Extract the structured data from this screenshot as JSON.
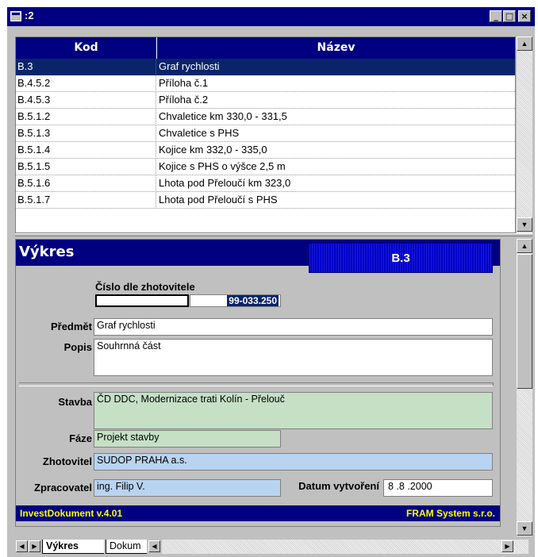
{
  "window": {
    "title": ":2",
    "minimize_glyph": "_",
    "maximize_glyph": "□",
    "close_glyph": "×"
  },
  "list": {
    "columns": [
      "Kod",
      "Název"
    ],
    "rows": [
      {
        "kod": "B.3",
        "nazev": "Graf rychlosti"
      },
      {
        "kod": "B.4.5.2",
        "nazev": "Příloha č.1"
      },
      {
        "kod": "B.4.5.3",
        "nazev": "Příloha č.2"
      },
      {
        "kod": "B.5.1.2",
        "nazev": "Chvaletice km 330,0 - 331,5"
      },
      {
        "kod": "B.5.1.3",
        "nazev": "Chvaletice s PHS"
      },
      {
        "kod": "B.5.1.4",
        "nazev": "Kojice km 332,0 - 335,0"
      },
      {
        "kod": "B.5.1.5",
        "nazev": "Kojice s PHS o výšce 2,5 m"
      },
      {
        "kod": "B.5.1.6",
        "nazev": "Lhota pod Přeloučí km 323,0"
      },
      {
        "kod": "B.5.1.7",
        "nazev": "Lhota pod Přeloučí s PHS"
      }
    ]
  },
  "form": {
    "title": "Výkres",
    "code": "B.3",
    "cislo_label": "Číslo dle zhotovitele",
    "cislo_value": "99-033.250",
    "predmet_label": "Předmět",
    "predmet_value": "Graf rychlosti",
    "popis_label": "Popis",
    "popis_value": "Souhrnná část",
    "stavba_label": "Stavba",
    "stavba_value": "ČD DDC, Modernizace trati Kolín - Přelouč",
    "faze_label": "Fáze",
    "faze_value": "Projekt stavby",
    "zhotovitel_label": "Zhotovitel",
    "zhotovitel_value": "SUDOP PRAHA a.s.",
    "zpracovatel_label": "Zpracovatel",
    "zpracovatel_value": "ing. Filip V.",
    "datum_label": "Datum vytvoření",
    "datum_value": "8 .8 .2000",
    "footer_left": "InvestDokument v.4.01",
    "footer_right": "FRAM System s.r.o."
  },
  "tabs": [
    "Výkres",
    "Dokum"
  ],
  "colors": {
    "header_blue": "#000080",
    "selection": "#0a246a",
    "footer_text": "#ffff00",
    "green_field": "#c6e0c6",
    "blue_field": "#b8d4f0"
  }
}
